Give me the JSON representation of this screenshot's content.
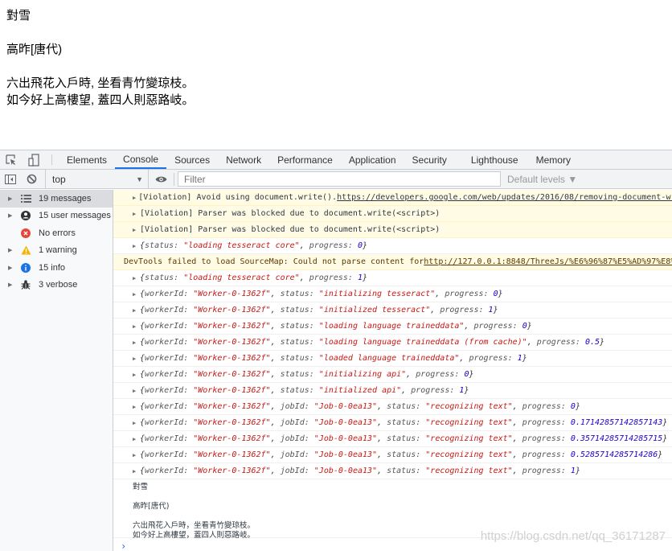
{
  "page": {
    "title": "對雪",
    "author": "高昨[唐代)",
    "lines": [
      "六出飛花入戶時, 坐看青竹變琼枝。",
      "如今好上高樓望, 蓋四人則惡路岐。"
    ]
  },
  "devtools": {
    "tabs": [
      {
        "label": "Elements",
        "active": false
      },
      {
        "label": "Console",
        "active": true
      },
      {
        "label": "Sources",
        "active": false
      },
      {
        "label": "Network",
        "active": false
      },
      {
        "label": "Performance",
        "active": false
      },
      {
        "label": "Application",
        "active": false
      },
      {
        "label": "Security",
        "active": false
      },
      {
        "label": "Lighthouse",
        "active": false
      },
      {
        "label": "Memory",
        "active": false
      }
    ],
    "toolbar": {
      "context": "top",
      "filter_placeholder": "Filter",
      "levels": "Default levels ▼"
    },
    "sidebar": [
      {
        "label": "19 messages",
        "icon": "list-icon",
        "selected": true
      },
      {
        "label": "15 user messages",
        "icon": "user-icon",
        "selected": false
      },
      {
        "label": "No errors",
        "icon": "error-icon",
        "selected": false
      },
      {
        "label": "1 warning",
        "icon": "warning-icon",
        "selected": false
      },
      {
        "label": "15 info",
        "icon": "info-icon",
        "selected": false
      },
      {
        "label": "3 verbose",
        "icon": "bug-icon",
        "selected": false
      }
    ],
    "console": {
      "violations": [
        {
          "text": "[Violation] Avoid using document.write(). ",
          "link": "https://developers.google.com/web/updates/2016/08/removing-document-write"
        },
        {
          "text": "[Violation] Parser was blocked due to document.write(<script>)"
        },
        {
          "text": "[Violation] Parser was blocked due to document.write(<script>)"
        }
      ],
      "core0": {
        "status": "\"loading tesseract core\"",
        "progress": "0"
      },
      "warning": {
        "text": "DevTools failed to load SourceMap: Could not parse content for ",
        "link": "http://127.0.0.1:8848/ThreeJs/%E6%96%87%E5%AD%97%E8%AF%86%E5%88%AB"
      },
      "core1": {
        "status": "\"loading tesseract core\"",
        "progress": "1"
      },
      "worker_logs": [
        {
          "workerId": "\"Worker-0-1362f\"",
          "status": "\"initializing tesseract\"",
          "progress": "0"
        },
        {
          "workerId": "\"Worker-0-1362f\"",
          "status": "\"initialized tesseract\"",
          "progress": "1"
        },
        {
          "workerId": "\"Worker-0-1362f\"",
          "status": "\"loading language traineddata\"",
          "progress": "0"
        },
        {
          "workerId": "\"Worker-0-1362f\"",
          "status": "\"loading language traineddata (from cache)\"",
          "progress": "0.5"
        },
        {
          "workerId": "\"Worker-0-1362f\"",
          "status": "\"loaded language traineddata\"",
          "progress": "1"
        },
        {
          "workerId": "\"Worker-0-1362f\"",
          "status": "\"initializing api\"",
          "progress": "0"
        },
        {
          "workerId": "\"Worker-0-1362f\"",
          "status": "\"initialized api\"",
          "progress": "1"
        }
      ],
      "job_logs": [
        {
          "workerId": "\"Worker-0-1362f\"",
          "jobId": "\"Job-0-0ea13\"",
          "status": "\"recognizing text\"",
          "progress": "0"
        },
        {
          "workerId": "\"Worker-0-1362f\"",
          "jobId": "\"Job-0-0ea13\"",
          "status": "\"recognizing text\"",
          "progress": "0.17142857142857143"
        },
        {
          "workerId": "\"Worker-0-1362f\"",
          "jobId": "\"Job-0-0ea13\"",
          "status": "\"recognizing text\"",
          "progress": "0.35714285714285715"
        },
        {
          "workerId": "\"Worker-0-1362f\"",
          "jobId": "\"Job-0-0ea13\"",
          "status": "\"recognizing text\"",
          "progress": "0.5285714285714286"
        },
        {
          "workerId": "\"Worker-0-1362f\"",
          "jobId": "\"Job-0-0ea13\"",
          "status": "\"recognizing text\"",
          "progress": "1"
        }
      ],
      "result_text": {
        "title": "對雪",
        "author": "高昨[唐代)",
        "line1": "六出飛花入戶時，坐看青竹變琼枝。",
        "line2": "如今好上高樓望，蓋四人則惡路岐。"
      },
      "prompt": "›"
    }
  },
  "watermark": "https://blog.csdn.net/qq_36171287"
}
